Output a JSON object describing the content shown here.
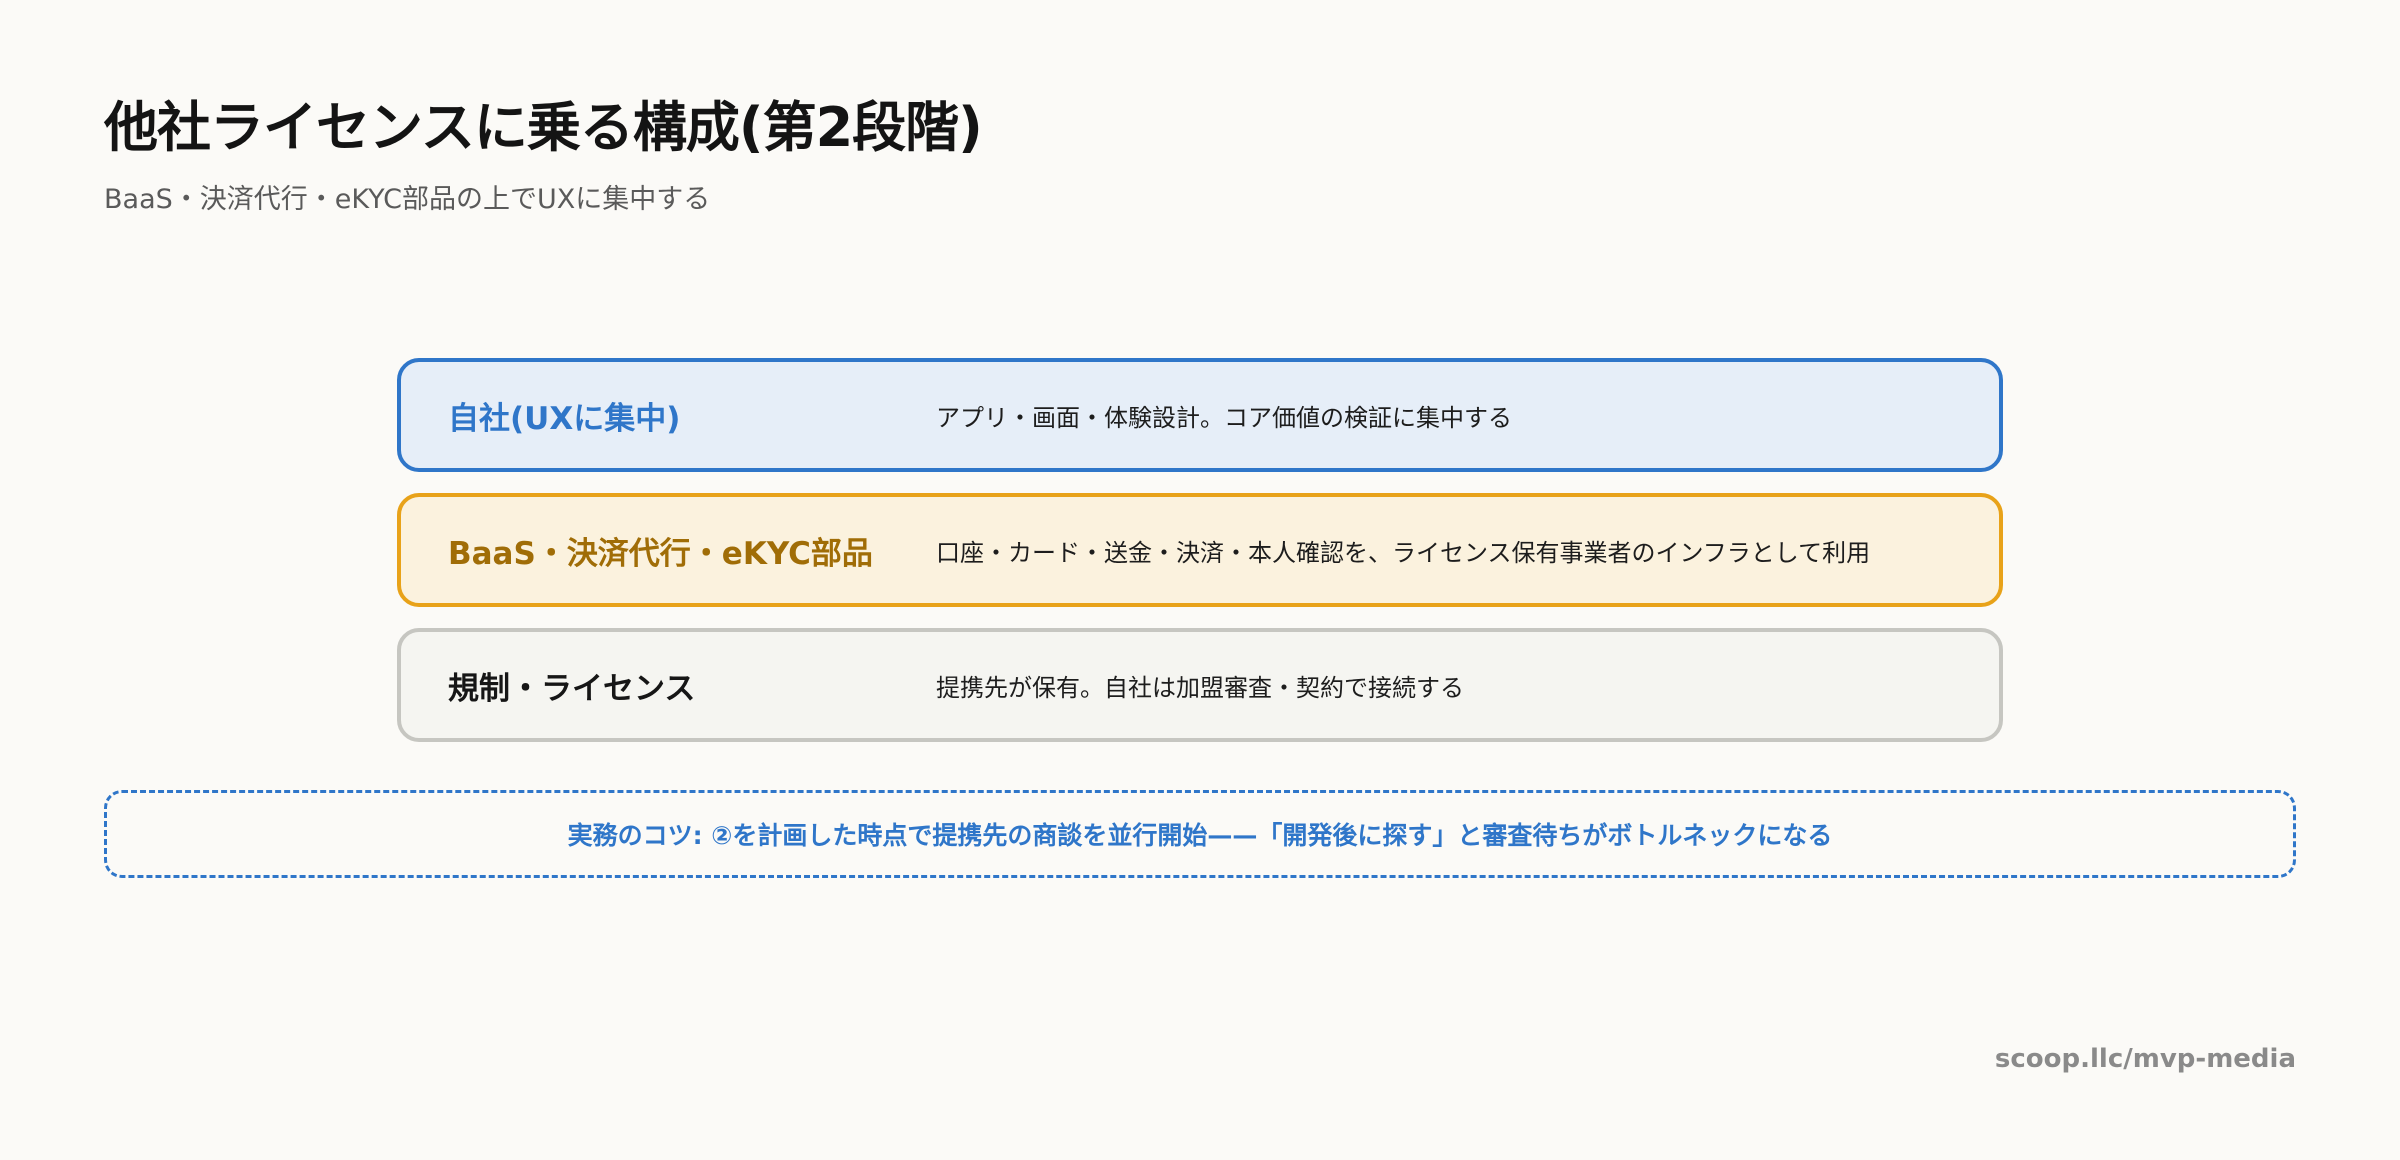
{
  "header": {
    "title": "他社ライセンスに乗る構成(第2段階)",
    "subtitle": "BaaS・決済代行・eKYC部品の上でUXに集中する"
  },
  "layers": [
    {
      "name": "自社(UXに集中)",
      "description": "アプリ・画面・体験設計。コア価値の検証に集中する",
      "border_color": "#2f76c9",
      "fill_color": "#e6eef8"
    },
    {
      "name": "BaaS・決済代行・eKYC部品",
      "description": "口座・カード・送金・決済・本人確認を、ライセンス保有事業者のインフラとして利用",
      "border_color": "#e8a219",
      "fill_color": "#fbf2de"
    },
    {
      "name": "規制・ライセンス",
      "description": "提携先が保有。自社は加盟審査・契約で接続する",
      "border_color": "#c6c6c1",
      "fill_color": "#f5f5f1"
    }
  ],
  "tip": {
    "text": "実務のコツ: ②を計画した時点で提携先の商談を並行開始——「開発後に探す」と審査待ちがボトルネックになる"
  },
  "footer": {
    "url": "scoop.llc/mvp-media"
  }
}
